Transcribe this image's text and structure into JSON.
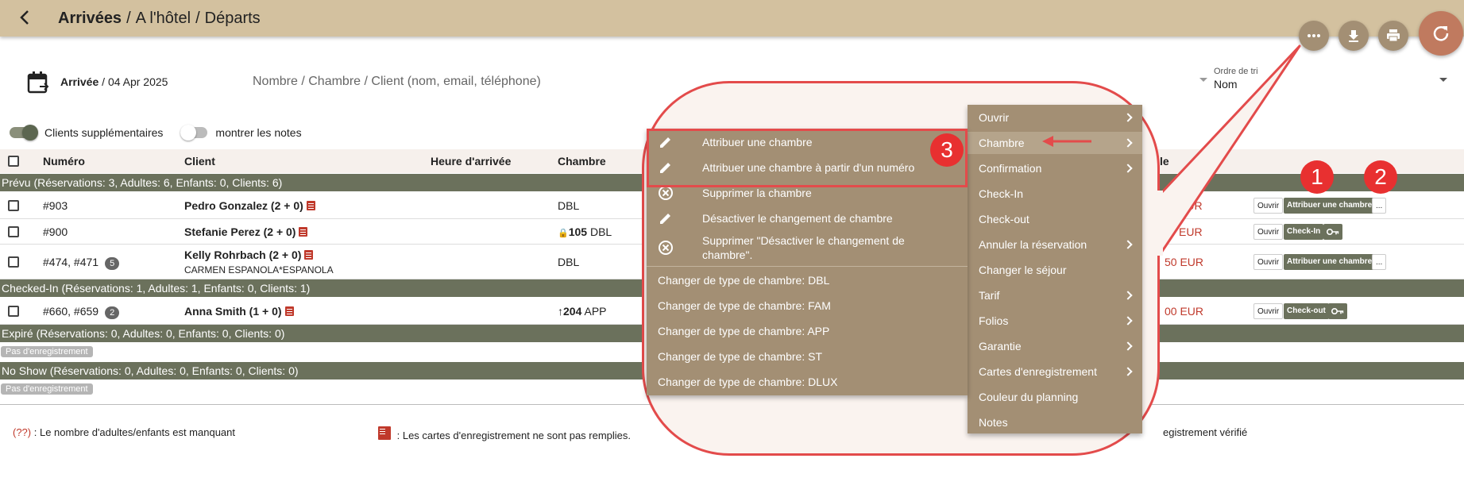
{
  "header": {
    "crumb_1": "Arrivées",
    "crumb_2": "A l'hôtel",
    "crumb_3": "Départs",
    "separator": "/"
  },
  "filters": {
    "arrival_label": "Arrivée",
    "arrival_date": "04 Apr 2025",
    "date_separator": " / ",
    "search_placeholder": "Nombre / Chambre / Client (nom, email, téléphone)",
    "sort_label": "Ordre de tri",
    "sort_value": "Nom"
  },
  "toggles": {
    "extra_clients": "Clients supplémentaires",
    "show_notes": "montrer les notes"
  },
  "columns": {
    "number": "Numéro",
    "client": "Client",
    "arrival_time": "Heure d'arrivée",
    "room": "Chambre"
  },
  "groups": {
    "planned": "Prévu (Réservations: 3, Adultes: 6, Enfants: 0, Clients: 6)",
    "checked_in": "Checked-In (Réservations: 1, Adultes: 1, Enfants: 0, Clients: 1)",
    "expired": "Expiré (Réservations: 0, Adultes: 0, Enfants: 0, Clients: 0)",
    "no_show": "No Show (Réservations: 0, Adultes: 0, Enfants: 0, Clients: 0)",
    "empty_tag": "Pas d'enregistrement"
  },
  "rows": [
    {
      "number": "#903",
      "client": "Pedro Gonzalez (2 + 0)",
      "room": "DBL",
      "room_prefix": "",
      "room_num": "",
      "amount": "EUR",
      "action": "Attribuer une chambre"
    },
    {
      "number": "#900",
      "client": "Stefanie Perez (2 + 0)",
      "room": "DBL",
      "room_prefix": "🔒",
      "room_num": "105",
      "amount": "EUR",
      "action": "Check-In"
    },
    {
      "number": "#474, #471",
      "count": "5",
      "client": "Kelly Rohrbach (2 + 0)",
      "subclient": "CARMEN ESPANOLA*ESPANOLA",
      "room": "DBL",
      "room_prefix": "",
      "room_num": "",
      "amount": "50 EUR",
      "action": "Attribuer une chambre"
    },
    {
      "number": "#660, #659",
      "count": "2",
      "client": "Anna Smith (1 + 0)",
      "room": "APP",
      "room_prefix": "↑",
      "room_num": "204",
      "amount": "00 EUR",
      "action": "Check-out"
    }
  ],
  "row_buttons": {
    "open": "Ouvrir",
    "more": "..."
  },
  "partial_header": "le",
  "legend": {
    "missing_marker": "(??)",
    "missing_text": " : Le nombre d'adultes/enfants est manquant",
    "cards_text": " : Les cartes d'enregistrement ne sont pas remplies.",
    "verified_text": "egistrement vérifié"
  },
  "main_menu": [
    {
      "label": "Ouvrir",
      "sub": true
    },
    {
      "label": "Chambre",
      "sub": true
    },
    {
      "label": "Confirmation",
      "sub": true
    },
    {
      "label": "Check-In",
      "sub": false
    },
    {
      "label": "Check-out",
      "sub": false
    },
    {
      "label": "Annuler la réservation",
      "sub": true
    },
    {
      "label": "Changer le séjour",
      "sub": false
    },
    {
      "label": "Tarif",
      "sub": true
    },
    {
      "label": "Folios",
      "sub": true
    },
    {
      "label": "Garantie",
      "sub": true
    },
    {
      "label": "Cartes d'enregistrement",
      "sub": true
    },
    {
      "label": "Couleur du planning",
      "sub": false
    },
    {
      "label": "Notes",
      "sub": false
    }
  ],
  "room_submenu": {
    "assign": "Attribuer une chambre",
    "assign_from_number": "Attribuer une chambre à partir d'un numéro",
    "delete": "Supprimer la chambre",
    "disable_change": "Désactiver le changement de chambre",
    "delete_disable_1": "Supprimer \"Désactiver le changement de",
    "delete_disable_2": "chambre\".",
    "types": [
      "Changer de type de chambre: DBL",
      "Changer de type de chambre: FAM",
      "Changer de type de chambre: APP",
      "Changer de type de chambre: ST",
      "Changer de type de chambre: DLUX"
    ]
  },
  "badges": {
    "one": "1",
    "two": "2",
    "three": "3"
  },
  "colors": {
    "topbar": "#d3c19f",
    "menu": "#a38f74",
    "group_row": "#6b715c",
    "annotation_red": "#e34b4b",
    "refresh": "#c07a5f"
  }
}
